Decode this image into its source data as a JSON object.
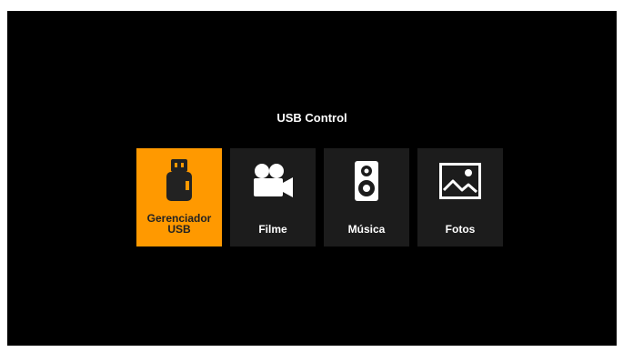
{
  "screen": {
    "title": "USB Control"
  },
  "menu": {
    "items": [
      {
        "label_line1": "Gerenciador",
        "label_line2": "USB",
        "icon": "usb-drive-icon",
        "selected": true
      },
      {
        "label": "Filme",
        "icon": "movie-camera-icon",
        "selected": false
      },
      {
        "label": "Música",
        "icon": "speaker-icon",
        "selected": false
      },
      {
        "label": "Fotos",
        "icon": "photo-icon",
        "selected": false
      }
    ]
  },
  "colors": {
    "background": "#000000",
    "tile": "#1c1c1c",
    "selected": "#ff9900",
    "text": "#ffffff"
  }
}
